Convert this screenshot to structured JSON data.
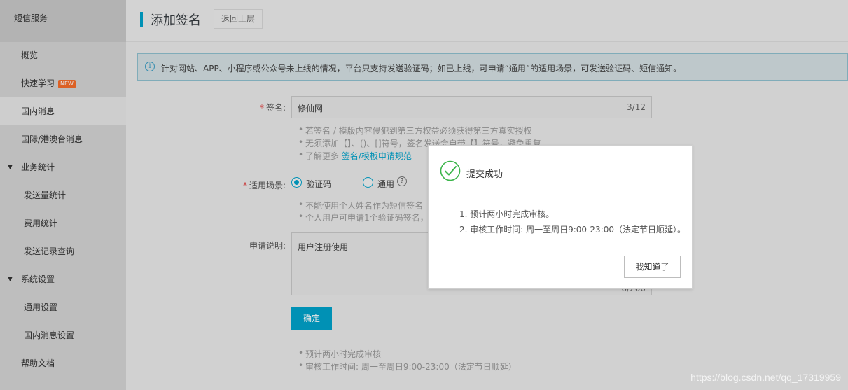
{
  "sidebar": {
    "header": "短信服务",
    "items": [
      {
        "label": "概览"
      },
      {
        "label": "快速学习",
        "badge": "NEW"
      },
      {
        "label": "国内消息"
      },
      {
        "label": "国际/港澳台消息"
      },
      {
        "label": "业务统计"
      },
      {
        "label": "发送量统计"
      },
      {
        "label": "费用统计"
      },
      {
        "label": "发送记录查询"
      },
      {
        "label": "系统设置"
      },
      {
        "label": "通用设置"
      },
      {
        "label": "国内消息设置"
      },
      {
        "label": "帮助文档"
      }
    ]
  },
  "header": {
    "title": "添加签名",
    "back_label": "返回上层"
  },
  "notice": {
    "text": "针对网站、APP、小程序或公众号未上线的情况，平台只支持发送验证码；如已上线，可申请“通用”的适用场景，可发送验证码、短信通知。"
  },
  "form": {
    "required_mark": "*",
    "signature_label": "签名:",
    "signature_value": "修仙网",
    "signature_count": "3/12",
    "signature_tips": [
      "若签名 / 模版内容侵犯到第三方权益必须获得第三方真实授权",
      "无须添加【】、()、[]符号，签名发送会自带【】符号，避免重复"
    ],
    "learn_more_prefix": "了解更多 ",
    "learn_more_link": "签名/模板申请规范",
    "scene_label": "适用场景:",
    "scene_options": [
      "验证码",
      "通用"
    ],
    "scene_tips": [
      "不能使用个人姓名作为短信签名",
      "个人用户可申请1个验证码签名，"
    ],
    "desc_label": "申请说明:",
    "desc_value": "用户注册使用",
    "desc_count": "6/200",
    "confirm_label": "确定",
    "bottom_tips": [
      "预计两小时完成审核",
      "审核工作时间: 周一至周日9:00-23:00（法定节日顺延）"
    ]
  },
  "dialog": {
    "title": "提交成功",
    "lines": [
      "1. 预计两小时完成审核。",
      "2. 审核工作时间: 周一至周日9:00-23:00（法定节日顺延）。"
    ],
    "ok_label": "我知道了"
  },
  "watermark": "https://blog.csdn.net/qq_17319959",
  "colors": {
    "accent": "#00a2ca",
    "success": "#3bb54a",
    "required": "#e04040"
  }
}
